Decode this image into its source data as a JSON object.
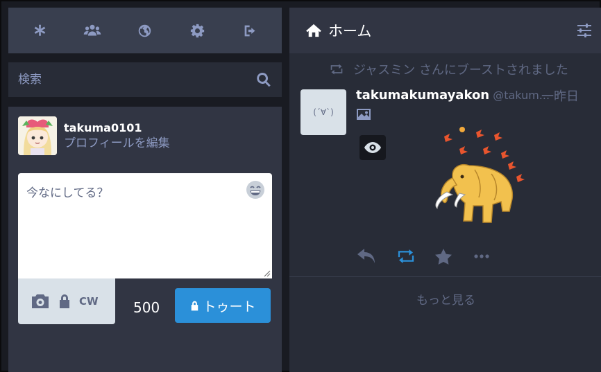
{
  "nav": {
    "items": [
      {
        "name": "getting-started-button",
        "icon": "asterisk-icon"
      },
      {
        "name": "community-button",
        "icon": "users-icon"
      },
      {
        "name": "federated-button",
        "icon": "globe-icon"
      },
      {
        "name": "settings-button",
        "icon": "gear-icon"
      },
      {
        "name": "logout-button",
        "icon": "sign-out-icon"
      }
    ],
    "icon_color": "#8d9ac2"
  },
  "search": {
    "placeholder": "検索"
  },
  "account": {
    "username": "takuma0101",
    "edit_profile": "プロフィールを編集"
  },
  "compose": {
    "placeholder": "今なにしてる？",
    "cw_label": "CW",
    "char_count": "500",
    "toot_label": "トゥート"
  },
  "column": {
    "title": "ホーム"
  },
  "status": {
    "boost_text": "ジャスミン さんにブーストされました",
    "display_name": "takumakumayakon",
    "acct": "@takum...",
    "time": "一昨日",
    "avatar_text": "(´∀`)"
  },
  "load_more": "もっと見る",
  "colors": {
    "accent": "#2b90d9",
    "background": "#191b22",
    "panel": "#282c37",
    "muted": "#606984"
  }
}
